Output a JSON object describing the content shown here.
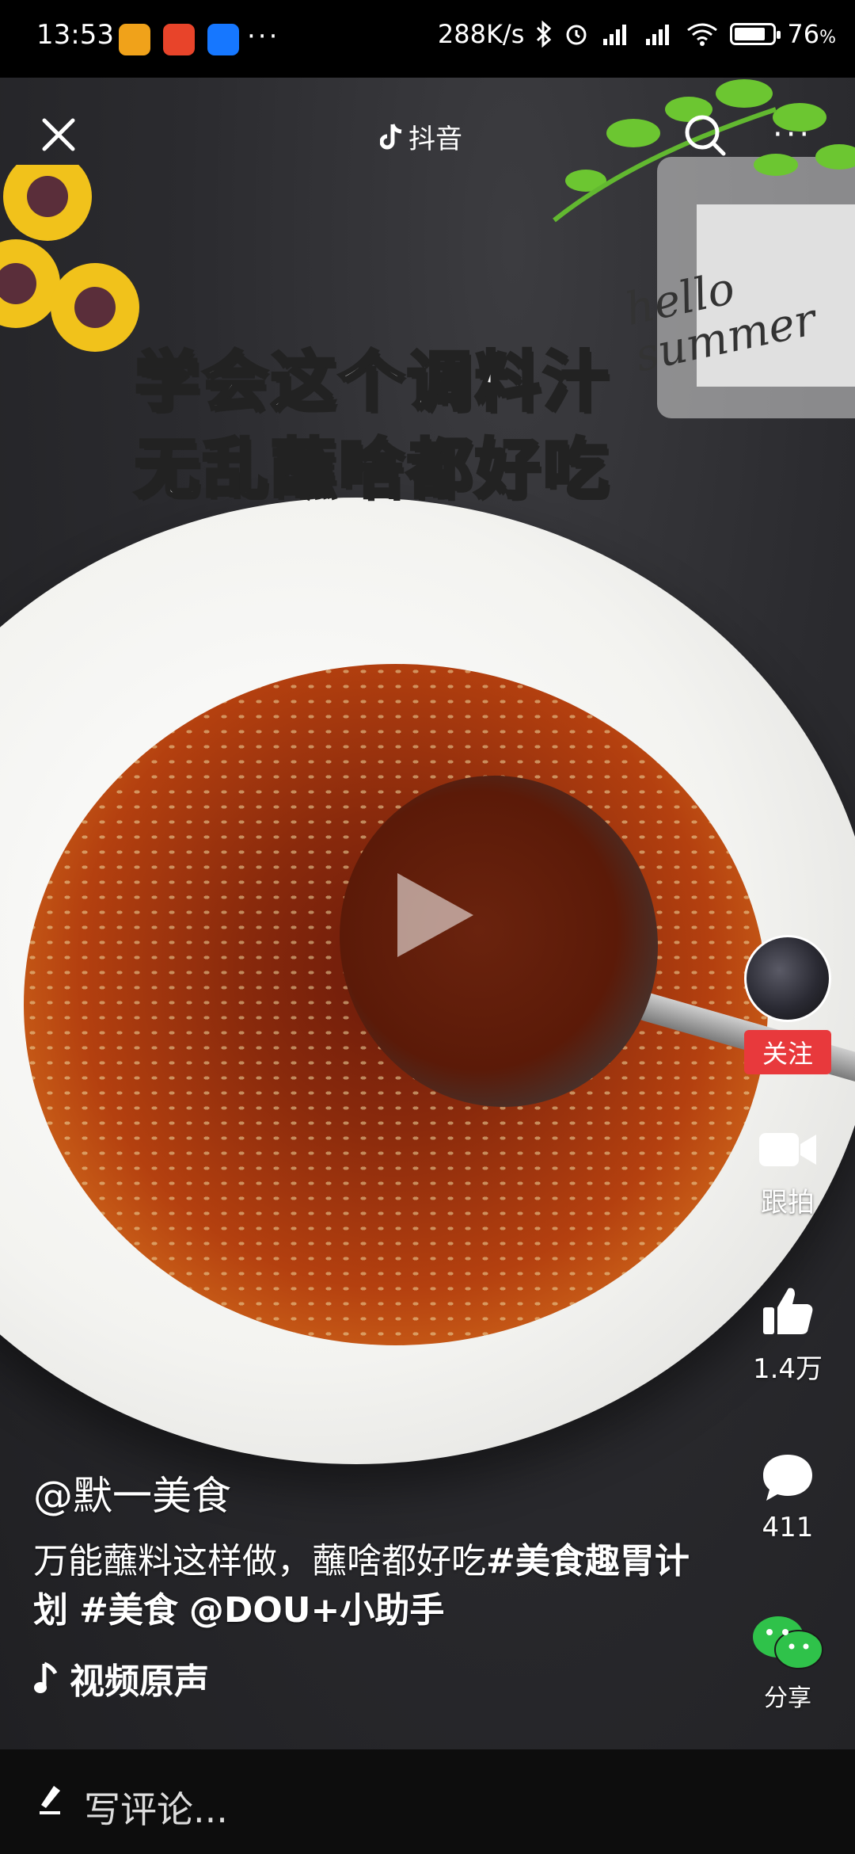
{
  "status_bar": {
    "time": "13:53",
    "network_speed": "288K/s",
    "battery": "76",
    "battery_unit": "%"
  },
  "top_bar": {
    "brand": "抖音"
  },
  "video": {
    "overlay_line1": "学会这个调料汁",
    "overlay_line2": "无乱蘸啥都好吃",
    "overlay_watermark": "hello summer"
  },
  "rail": {
    "follow_label": "关注",
    "duet_label": "跟拍",
    "likes": "1.4万",
    "comments": "411",
    "share_label": "分享"
  },
  "caption": {
    "author": "@默一美食",
    "desc_plain": "万能蘸料这样做，蘸啥都好吃",
    "desc_tag1": "#美食趣胃计划",
    "desc_tag2": "#美食",
    "desc_mention": "@DOU+小助手",
    "music": "视频原声"
  },
  "comment_bar": {
    "placeholder": "写评论..."
  },
  "colors": {
    "follow_red": "#e8393c",
    "wechat_green": "#2fc24a"
  }
}
